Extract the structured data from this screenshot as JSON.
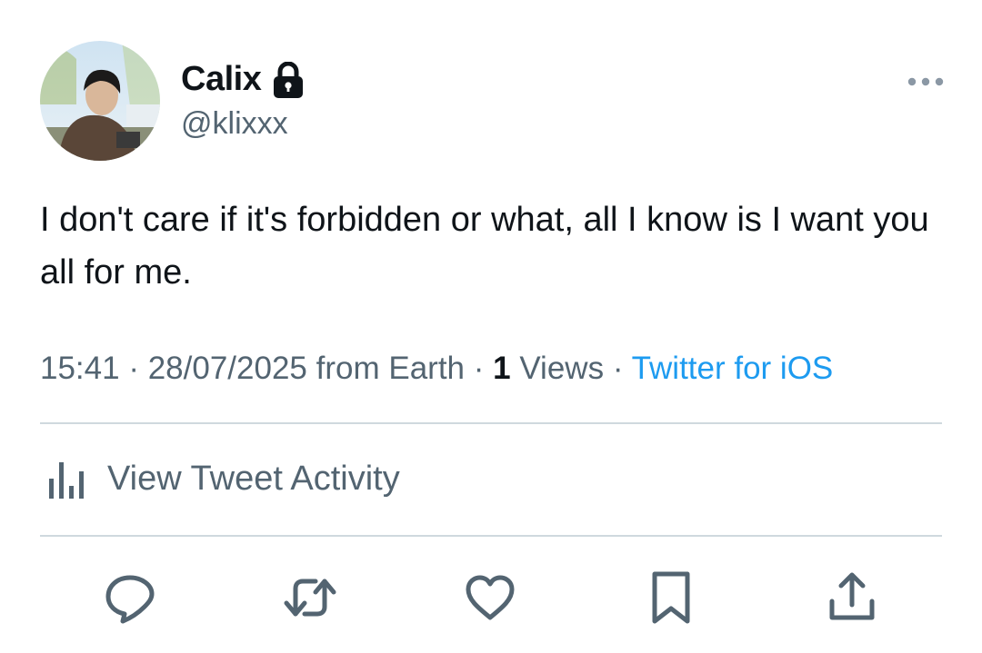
{
  "tweet": {
    "author": {
      "display_name": "Calix",
      "handle": "@klixxx",
      "protected_icon": "lock-icon"
    },
    "text": "I don't care if it's forbidden or what, all I know is I want you all for me.",
    "meta": {
      "time": "15:41",
      "date": "28/07/2025",
      "location": "from Earth",
      "views_count": "1",
      "views_label": "Views",
      "source": "Twitter for iOS",
      "separator": "·"
    },
    "activity_label": "View Tweet Activity"
  },
  "actions": [
    "reply-icon",
    "retweet-icon",
    "like-icon",
    "bookmark-icon",
    "share-icon"
  ],
  "colors": {
    "text": "#0f1419",
    "secondary": "#536471",
    "link": "#1d9bf0",
    "divider": "#cfd9de"
  }
}
